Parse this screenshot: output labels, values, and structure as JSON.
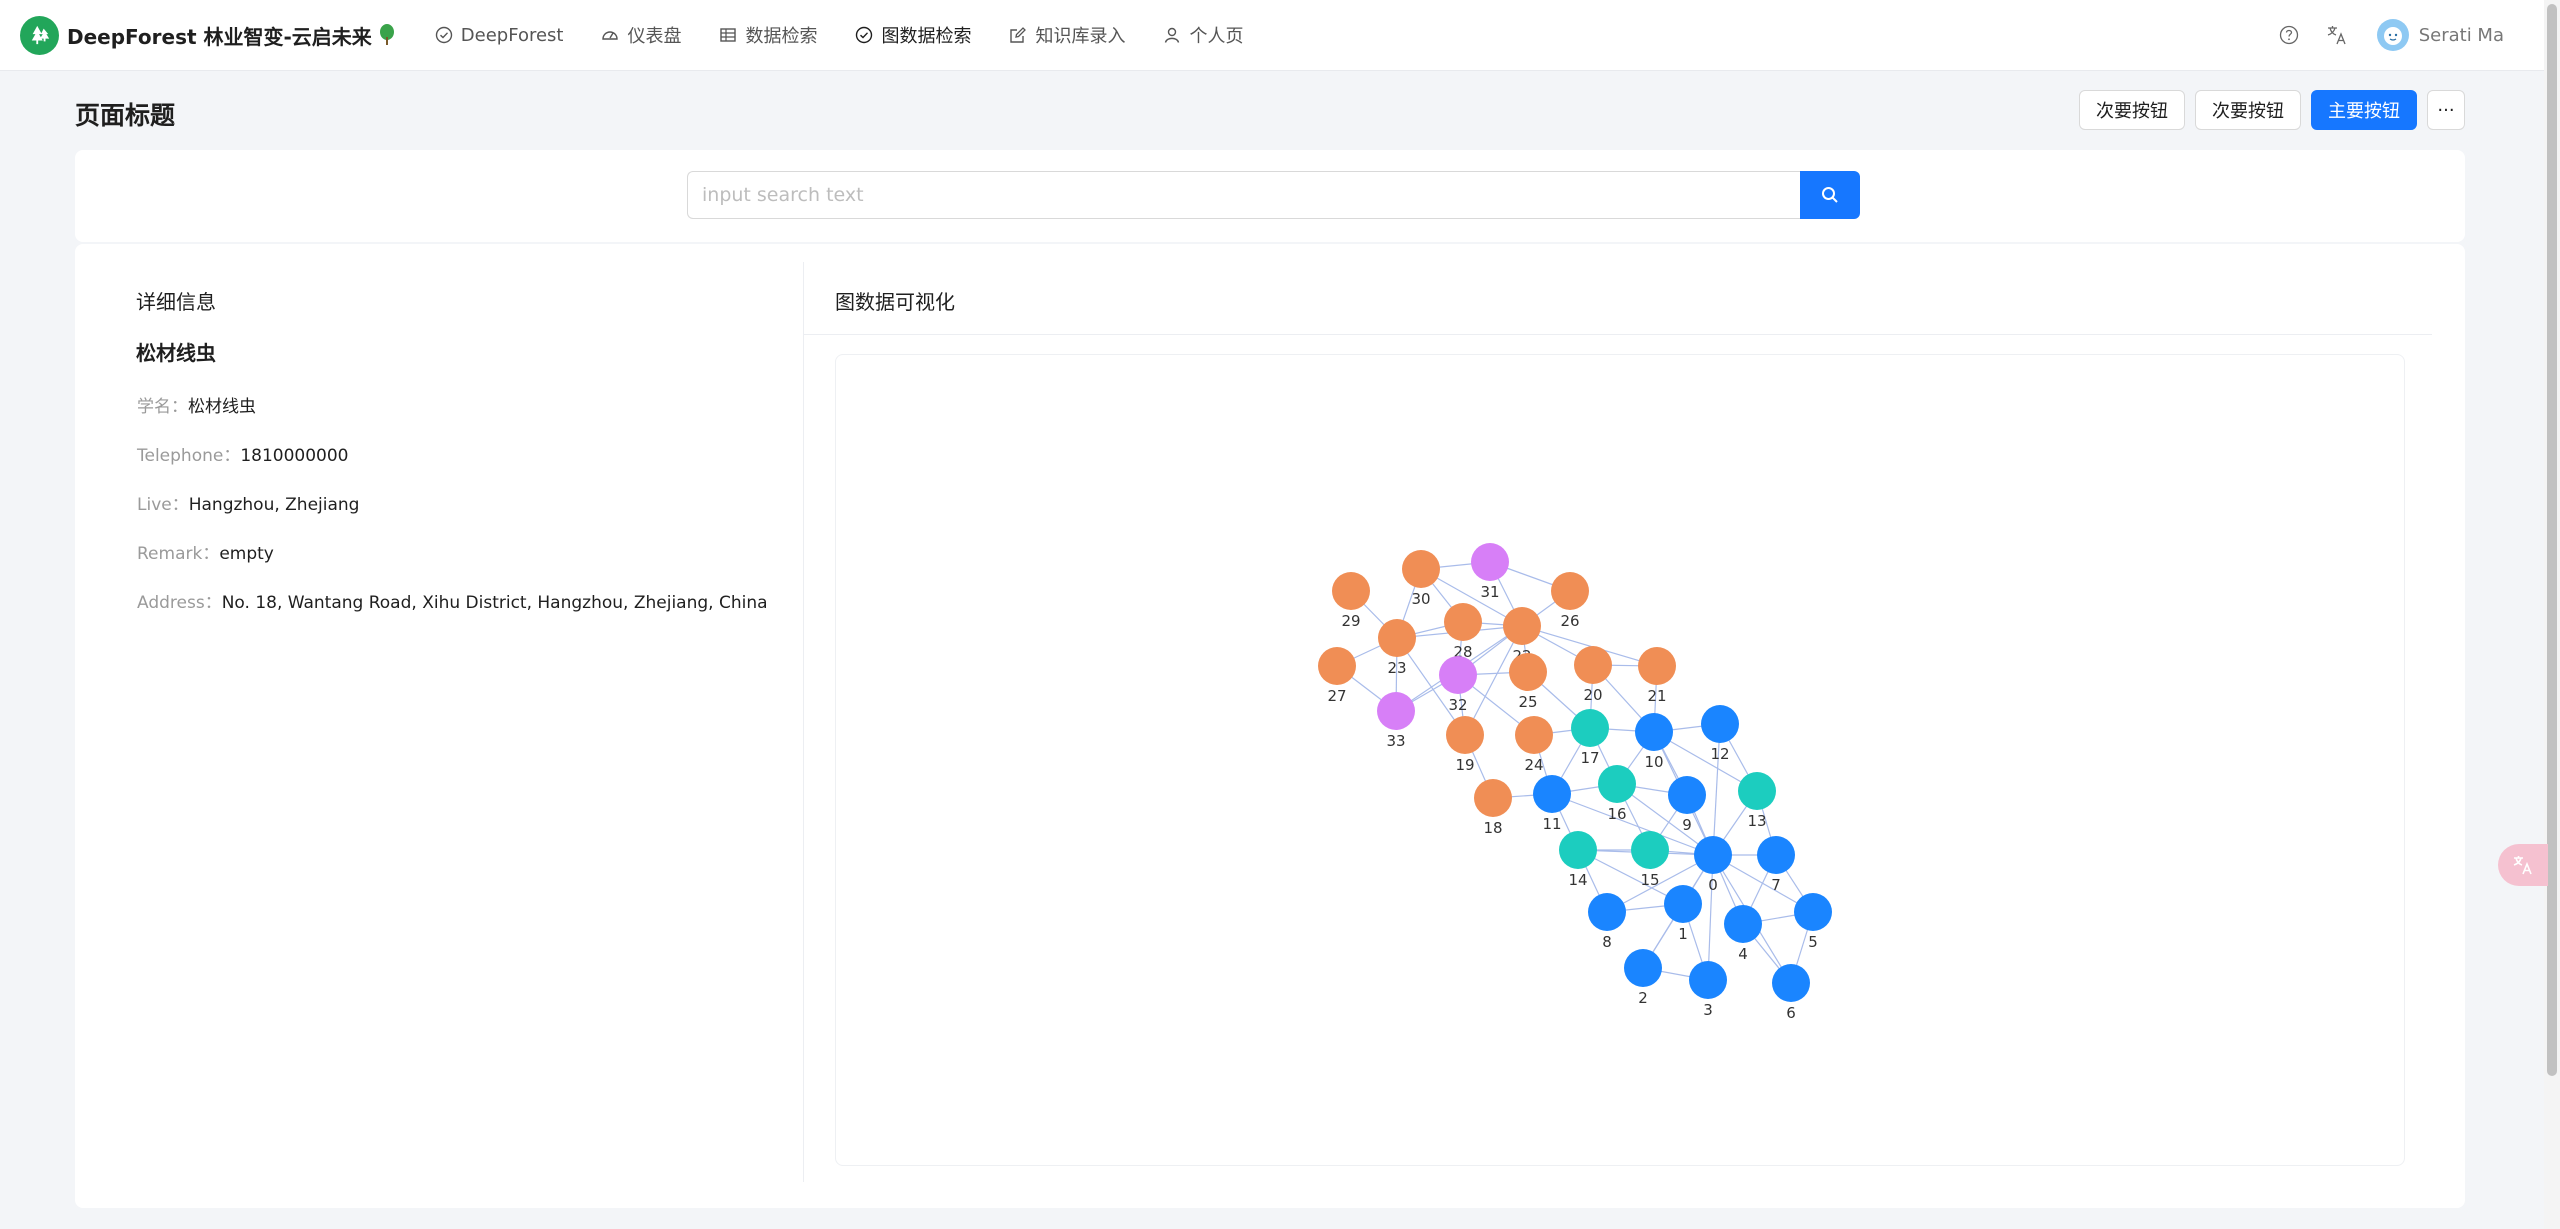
{
  "brand": {
    "title": "DeepForest 林业智变-云启未来"
  },
  "nav": [
    {
      "label": "DeepForest",
      "icon": "check-circle-icon",
      "active": false
    },
    {
      "label": "仪表盘",
      "icon": "dashboard-icon",
      "active": false
    },
    {
      "label": "数据检索",
      "icon": "table-icon",
      "active": false
    },
    {
      "label": "图数据检索",
      "icon": "check-circle-icon",
      "active": true
    },
    {
      "label": "知识库录入",
      "icon": "edit-icon",
      "active": false
    },
    {
      "label": "个人页",
      "icon": "user-icon",
      "active": false
    }
  ],
  "user": {
    "name": "Serati Ma"
  },
  "page": {
    "title": "页面标题",
    "secondary_btn_1": "次要按钮",
    "secondary_btn_2": "次要按钮",
    "primary_btn": "主要按钮",
    "more_btn": "···"
  },
  "search": {
    "placeholder": "input search text",
    "value": ""
  },
  "detail": {
    "section_title": "详细信息",
    "name": "松材线虫",
    "rows": [
      {
        "label": "学名：",
        "value": "松材线虫"
      },
      {
        "label": "Telephone：",
        "value": "1810000000"
      },
      {
        "label": "Live：",
        "value": "Hangzhou, Zhejiang"
      },
      {
        "label": "Remark：",
        "value": "empty"
      },
      {
        "label": "Address：",
        "value": "No. 18, Wantang Road, Xihu District, Hangzhou, Zhejiang, China"
      }
    ]
  },
  "graph": {
    "title": "图数据可视化",
    "colors": {
      "blue": "#1a85ff",
      "teal": "#1ccdbf",
      "orange": "#f08e55",
      "purple": "#d77ff7",
      "edge": "#a9bcea"
    },
    "nodes": [
      {
        "id": "0",
        "group": "blue"
      },
      {
        "id": "1",
        "group": "blue"
      },
      {
        "id": "2",
        "group": "blue"
      },
      {
        "id": "3",
        "group": "blue"
      },
      {
        "id": "4",
        "group": "blue"
      },
      {
        "id": "5",
        "group": "blue"
      },
      {
        "id": "6",
        "group": "blue"
      },
      {
        "id": "7",
        "group": "blue"
      },
      {
        "id": "8",
        "group": "blue"
      },
      {
        "id": "9",
        "group": "blue"
      },
      {
        "id": "10",
        "group": "blue"
      },
      {
        "id": "11",
        "group": "blue"
      },
      {
        "id": "12",
        "group": "blue"
      },
      {
        "id": "13",
        "group": "teal"
      },
      {
        "id": "14",
        "group": "teal"
      },
      {
        "id": "15",
        "group": "teal"
      },
      {
        "id": "16",
        "group": "teal"
      },
      {
        "id": "17",
        "group": "teal"
      },
      {
        "id": "18",
        "group": "orange"
      },
      {
        "id": "19",
        "group": "orange"
      },
      {
        "id": "20",
        "group": "orange"
      },
      {
        "id": "21",
        "group": "orange"
      },
      {
        "id": "22",
        "group": "orange"
      },
      {
        "id": "23",
        "group": "orange"
      },
      {
        "id": "24",
        "group": "orange"
      },
      {
        "id": "25",
        "group": "orange"
      },
      {
        "id": "26",
        "group": "orange"
      },
      {
        "id": "27",
        "group": "orange"
      },
      {
        "id": "28",
        "group": "orange"
      },
      {
        "id": "29",
        "group": "orange"
      },
      {
        "id": "30",
        "group": "orange"
      },
      {
        "id": "31",
        "group": "purple"
      },
      {
        "id": "32",
        "group": "purple"
      },
      {
        "id": "33",
        "group": "purple"
      }
    ],
    "edges": [
      [
        "0",
        "1"
      ],
      [
        "0",
        "2"
      ],
      [
        "0",
        "3"
      ],
      [
        "0",
        "4"
      ],
      [
        "0",
        "5"
      ],
      [
        "0",
        "6"
      ],
      [
        "0",
        "7"
      ],
      [
        "0",
        "8"
      ],
      [
        "0",
        "9"
      ],
      [
        "0",
        "10"
      ],
      [
        "0",
        "11"
      ],
      [
        "0",
        "12"
      ],
      [
        "0",
        "13"
      ],
      [
        "0",
        "14"
      ],
      [
        "0",
        "15"
      ],
      [
        "0",
        "16"
      ],
      [
        "1",
        "2"
      ],
      [
        "1",
        "3"
      ],
      [
        "1",
        "8"
      ],
      [
        "1",
        "14"
      ],
      [
        "2",
        "3"
      ],
      [
        "4",
        "5"
      ],
      [
        "4",
        "6"
      ],
      [
        "4",
        "7"
      ],
      [
        "5",
        "6"
      ],
      [
        "5",
        "7"
      ],
      [
        "7",
        "13"
      ],
      [
        "8",
        "14"
      ],
      [
        "9",
        "15"
      ],
      [
        "9",
        "16"
      ],
      [
        "9",
        "10"
      ],
      [
        "10",
        "12"
      ],
      [
        "10",
        "13"
      ],
      [
        "10",
        "16"
      ],
      [
        "10",
        "17"
      ],
      [
        "10",
        "20"
      ],
      [
        "10",
        "21"
      ],
      [
        "11",
        "16"
      ],
      [
        "11",
        "14"
      ],
      [
        "11",
        "18"
      ],
      [
        "11",
        "24"
      ],
      [
        "11",
        "17"
      ],
      [
        "12",
        "13"
      ],
      [
        "14",
        "15"
      ],
      [
        "15",
        "16"
      ],
      [
        "16",
        "17"
      ],
      [
        "17",
        "24"
      ],
      [
        "17",
        "20"
      ],
      [
        "17",
        "25"
      ],
      [
        "18",
        "19"
      ],
      [
        "19",
        "22"
      ],
      [
        "19",
        "23"
      ],
      [
        "19",
        "32"
      ],
      [
        "20",
        "22"
      ],
      [
        "20",
        "21"
      ],
      [
        "21",
        "22"
      ],
      [
        "22",
        "23"
      ],
      [
        "22",
        "25"
      ],
      [
        "22",
        "26"
      ],
      [
        "22",
        "28"
      ],
      [
        "22",
        "30"
      ],
      [
        "22",
        "31"
      ],
      [
        "22",
        "33"
      ],
      [
        "22",
        "32"
      ],
      [
        "23",
        "27"
      ],
      [
        "23",
        "28"
      ],
      [
        "23",
        "29"
      ],
      [
        "23",
        "30"
      ],
      [
        "23",
        "33"
      ],
      [
        "24",
        "32"
      ],
      [
        "25",
        "32"
      ],
      [
        "26",
        "31"
      ],
      [
        "27",
        "33"
      ],
      [
        "28",
        "32"
      ],
      [
        "28",
        "30"
      ],
      [
        "30",
        "31"
      ],
      [
        "32",
        "33"
      ]
    ]
  }
}
